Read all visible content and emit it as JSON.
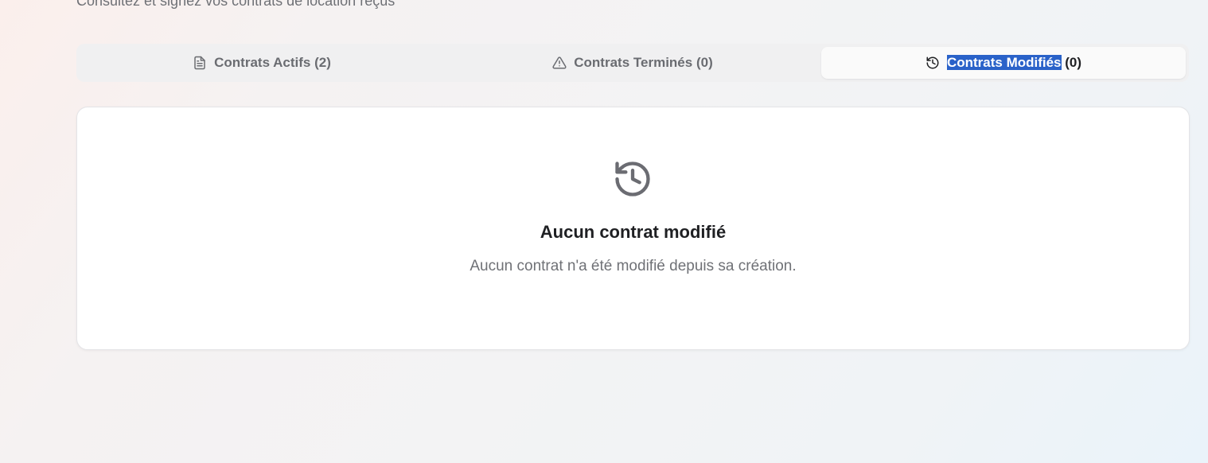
{
  "header": {
    "subtitle": "Consultez et signez vos contrats de location reçus"
  },
  "tabs": [
    {
      "label": "Contrats Actifs",
      "count": "(2)",
      "icon": "file-text-icon",
      "active": false
    },
    {
      "label": "Contrats Terminés",
      "count": "(0)",
      "icon": "alert-triangle-icon",
      "active": false
    },
    {
      "label": "Contrats Modifiés",
      "count": "(0)",
      "icon": "history-icon",
      "active": true
    }
  ],
  "empty_state": {
    "icon": "history-icon",
    "title": "Aucun contrat modifié",
    "description": "Aucun contrat n'a été modifié depuis sa création."
  },
  "colors": {
    "selection_highlight": "#2a62c9",
    "icon_gray": "#6b6c72"
  }
}
